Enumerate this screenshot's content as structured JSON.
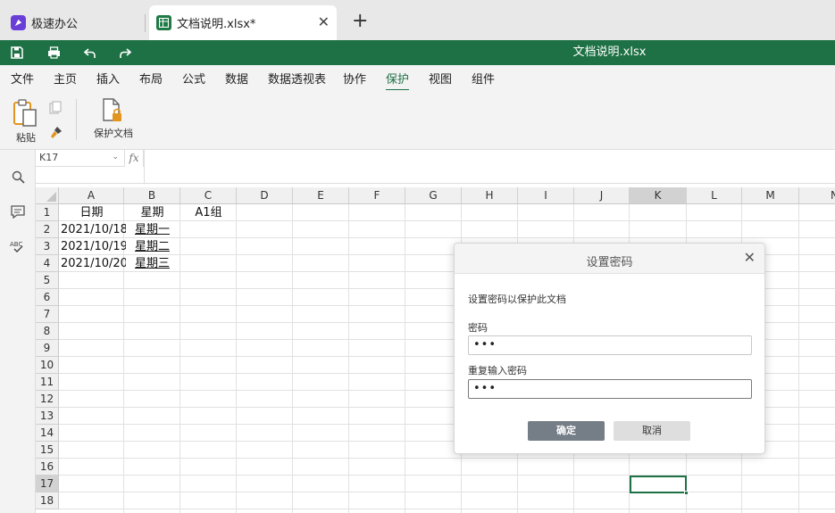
{
  "tabs": [
    {
      "label": "极速办公",
      "icon": "app-logo-icon"
    },
    {
      "label": "文档说明.xlsx*",
      "icon": "spreadsheet-icon"
    }
  ],
  "title": "文档说明.xlsx",
  "menu": [
    "文件",
    "主页",
    "插入",
    "布局",
    "公式",
    "数据",
    "数据透视表",
    "协作",
    "保护",
    "视图",
    "组件"
  ],
  "active_menu": "保护",
  "ribbon": {
    "paste": "粘贴",
    "protect_doc": "保护文档"
  },
  "name_box": "K17",
  "fx_label": "fx",
  "columns": [
    "A",
    "B",
    "C",
    "D",
    "E",
    "F",
    "G",
    "H",
    "I",
    "J",
    "K",
    "L",
    "M",
    "N"
  ],
  "selected_column": "K",
  "rows": [
    "1",
    "2",
    "3",
    "4",
    "5",
    "6",
    "7",
    "8",
    "9",
    "10",
    "11",
    "12",
    "13",
    "14",
    "15",
    "16",
    "17",
    "18"
  ],
  "selected_row": "17",
  "cells": {
    "A1": "日期",
    "B1": "星期",
    "C1": "A1组",
    "A2": "2021/10/18",
    "B2": "星期一",
    "A3": "2021/10/19",
    "B3": "星期二",
    "A4": "2021/10/20",
    "B4": "星期三"
  },
  "dialog": {
    "title": "设置密码",
    "description": "设置密码以保护此文档",
    "password_label": "密码",
    "password_value": "•••",
    "repeat_label": "重复输入密码",
    "repeat_value": "•••",
    "ok": "确定",
    "cancel": "取消"
  },
  "colors": {
    "accent": "#1e7145",
    "brand": "#6a3fd8"
  }
}
